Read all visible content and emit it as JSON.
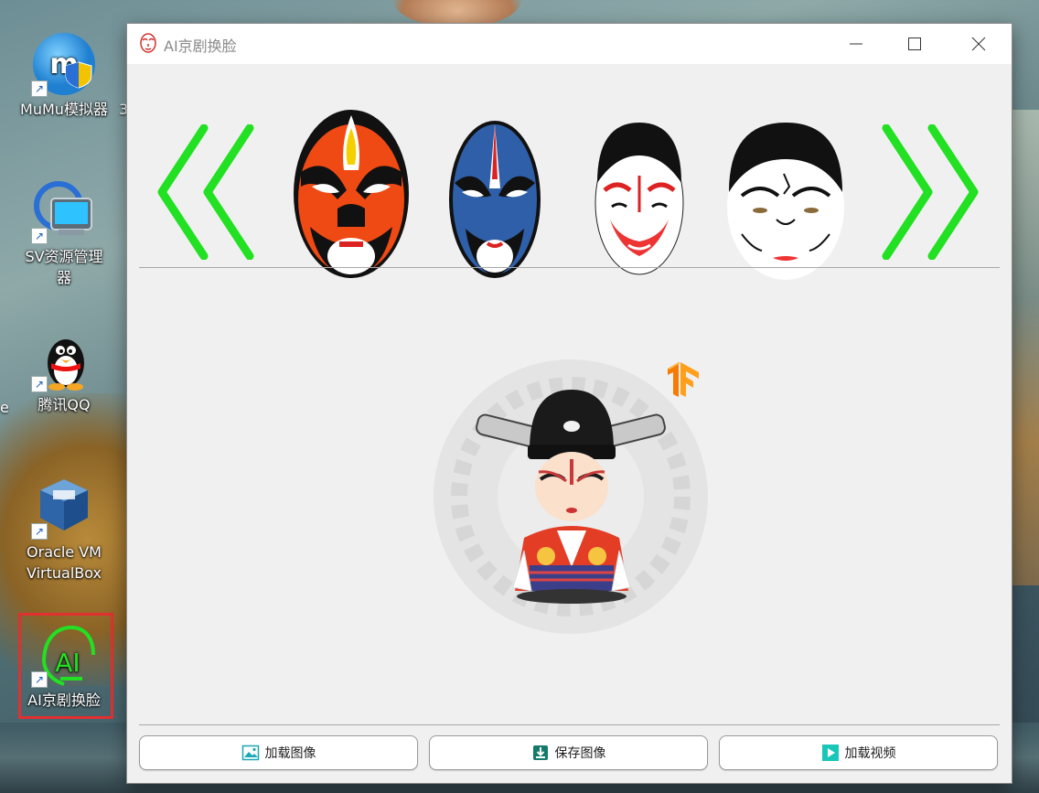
{
  "desktop": {
    "icons": [
      {
        "label": "MuMu模拟器",
        "icon": "mumu-emulator-icon"
      },
      {
        "label": "SV资源管理器",
        "icon": "sv-explorer-icon"
      },
      {
        "label": "腾讯QQ",
        "icon": "qq-penguin-icon"
      },
      {
        "label": "Oracle VM VirtualBox",
        "icon": "virtualbox-icon"
      },
      {
        "label": "AI京剧换脸",
        "icon": "ai-opera-icon"
      }
    ],
    "partial_left": "e",
    "partial_right": "3"
  },
  "window": {
    "title": "AI京剧换脸",
    "controls": [
      "minimize-icon",
      "maximize-icon",
      "close-icon"
    ],
    "masks": [
      "red-black-opera-mask",
      "blue-black-opera-mask",
      "white-red-opera-mask",
      "white-black-opera-mask"
    ],
    "nav": {
      "prev": "double-chevron-left-icon",
      "next": "double-chevron-right-icon"
    },
    "buttons": [
      {
        "label": "加载图像",
        "icon": "image-icon"
      },
      {
        "label": "保存图像",
        "icon": "save-icon"
      },
      {
        "label": "加载视频",
        "icon": "play-icon"
      }
    ]
  },
  "colors": {
    "arrow_green": "#22e022",
    "selection_red": "#e23030",
    "tensorflow_orange": "#f57c00"
  }
}
